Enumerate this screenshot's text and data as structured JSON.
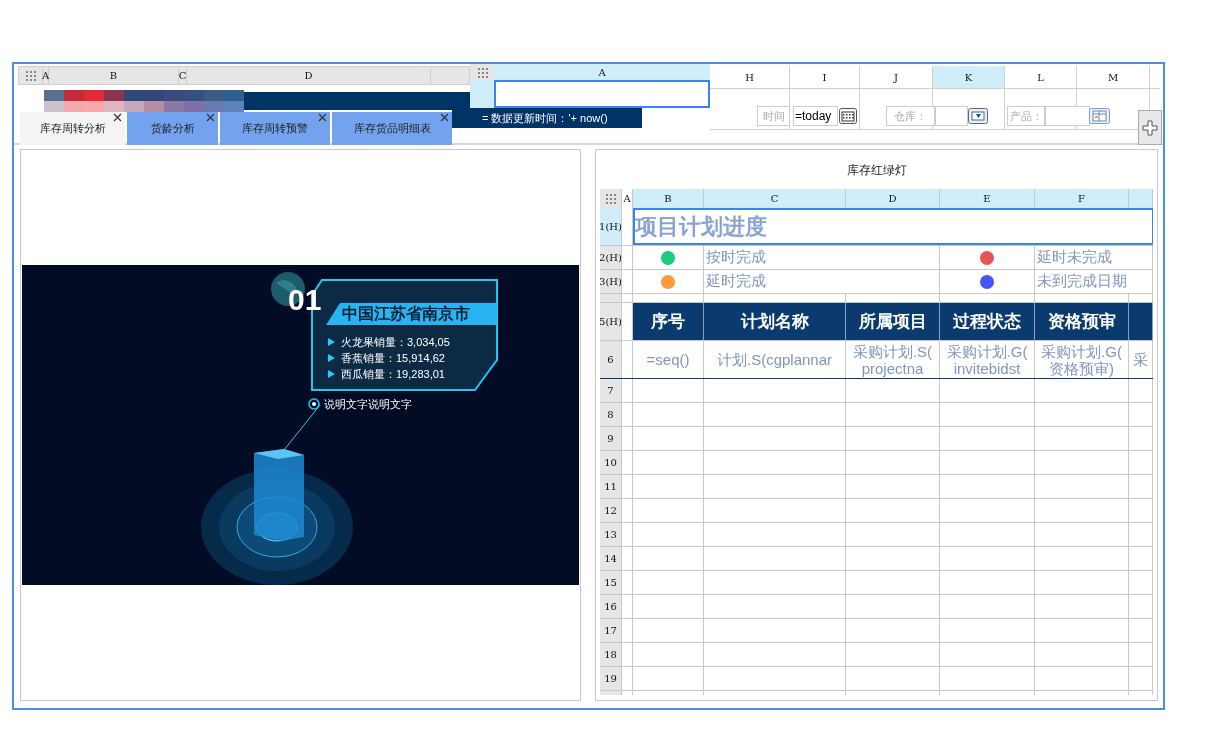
{
  "left_sheet": {
    "columns": [
      "A",
      "B",
      "C",
      "D"
    ]
  },
  "tabs": [
    {
      "label": "库存周转分析",
      "selected": true
    },
    {
      "label": "货龄分析",
      "selected": false
    },
    {
      "label": "库存周转预警",
      "selected": false
    },
    {
      "label": "库存货品明细表",
      "selected": false
    }
  ],
  "mid_sheet": {
    "columns": [
      "A"
    ],
    "banner": "= 数据更新时间：'+ now()"
  },
  "right_sheet": {
    "columns": [
      {
        "label": "H",
        "selected": false
      },
      {
        "label": "I",
        "selected": false
      },
      {
        "label": "J",
        "selected": false
      },
      {
        "label": "K",
        "selected": true
      },
      {
        "label": "L",
        "selected": false
      },
      {
        "label": "M",
        "selected": false
      }
    ]
  },
  "filters": [
    {
      "kind": "date",
      "label": "时间",
      "value": "=today"
    },
    {
      "kind": "combo",
      "label": "仓库："
    },
    {
      "kind": "tree",
      "label": "产品："
    }
  ],
  "image_panel": {
    "badge": "01",
    "city": "中国江苏省南京市",
    "stats": [
      "火龙果销量：3,034,05",
      "香蕉销量：15,914,62",
      "西瓜销量：19,283,01"
    ],
    "caption": "说明文字说明文字"
  },
  "report": {
    "title": "库存红绿灯",
    "columns": [
      "A",
      "B",
      "C",
      "D",
      "E",
      "F"
    ],
    "rows": [
      {
        "kind": "title",
        "label": "1(H)",
        "text": "项目计划进度"
      },
      {
        "kind": "legend",
        "label": "2(H)",
        "items": [
          {
            "color": "#1dcb7c",
            "text": "按时完成"
          },
          {
            "color": "#e95454",
            "text": "延时未完成"
          }
        ]
      },
      {
        "kind": "legend",
        "label": "3(H)",
        "items": [
          {
            "color": "#ff9a3d",
            "text": "延时完成"
          },
          {
            "color": "#4455f5",
            "text": "未到完成日期"
          }
        ]
      },
      {
        "kind": "hidden"
      },
      {
        "kind": "header",
        "label": "5(H)",
        "cells": [
          "序号",
          "计划名称",
          "所属项目",
          "过程状态",
          "资格预审"
        ]
      },
      {
        "kind": "formula",
        "label": "6",
        "cells": [
          [
            "=seq()"
          ],
          [
            "计划.S(cgplannar"
          ],
          [
            "采购计划.S(",
            "projectna"
          ],
          [
            "采购计划.G(",
            "invitebidst"
          ],
          [
            "采购计划.G(",
            "资格预审)"
          ],
          [
            "采"
          ]
        ]
      },
      {
        "kind": "empty",
        "label": "7"
      },
      {
        "kind": "empty",
        "label": "8"
      },
      {
        "kind": "empty",
        "label": "9"
      },
      {
        "kind": "empty",
        "label": "10"
      },
      {
        "kind": "empty",
        "label": "11"
      },
      {
        "kind": "empty",
        "label": "12"
      },
      {
        "kind": "empty",
        "label": "13"
      },
      {
        "kind": "empty",
        "label": "14"
      },
      {
        "kind": "empty",
        "label": "15"
      },
      {
        "kind": "empty",
        "label": "16"
      },
      {
        "kind": "empty",
        "label": "17"
      },
      {
        "kind": "empty",
        "label": "18"
      },
      {
        "kind": "empty",
        "label": "19"
      },
      {
        "kind": "partial"
      }
    ]
  }
}
